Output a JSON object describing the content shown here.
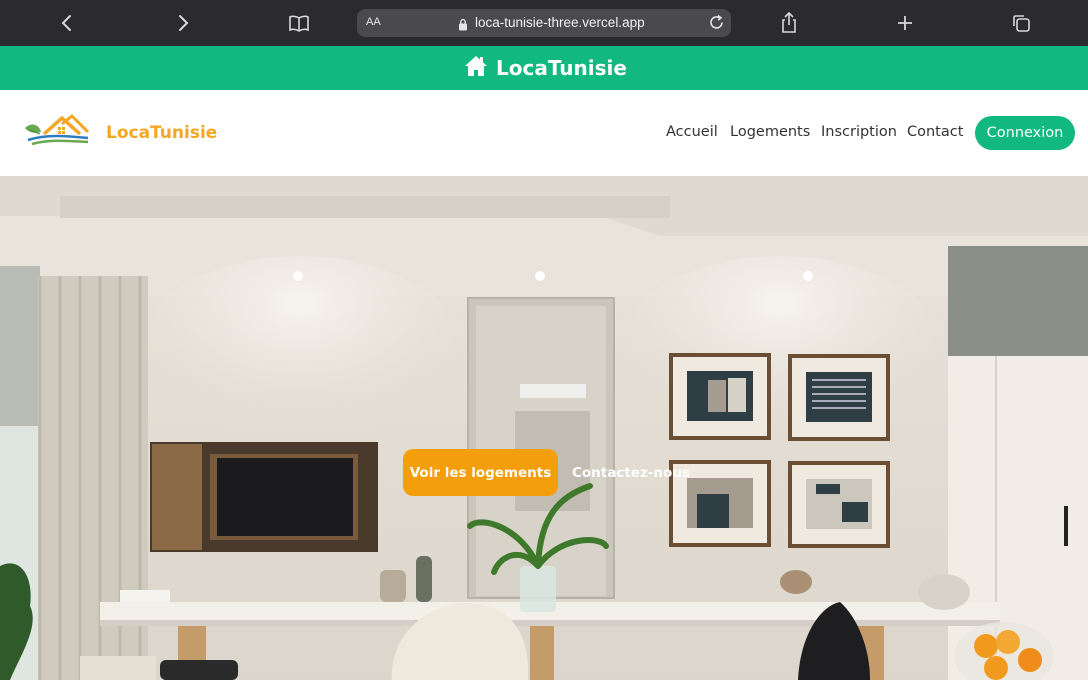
{
  "browser": {
    "address_aa": "AA",
    "url": "loca-tunisie-three.vercel.app",
    "icons": [
      "back-icon",
      "forward-icon",
      "bookmarks-icon",
      "lock-icon",
      "reload-icon",
      "share-icon",
      "add-tab-icon",
      "tabs-icon"
    ]
  },
  "app_bar": {
    "title": "LocaTunisie",
    "icon": "home-icon"
  },
  "nav": {
    "brand": "LocaTunisie",
    "links": [
      "Accueil",
      "Logements",
      "Inscription",
      "Contact"
    ],
    "login_label": "Connexion"
  },
  "hero": {
    "primary_cta": "Voir les logements",
    "secondary_cta": "Contactez-nous"
  },
  "colors": {
    "browser_chrome": "#2b2b2e",
    "brand_green": "#11b981",
    "brand_orange": "#f59e0b"
  }
}
